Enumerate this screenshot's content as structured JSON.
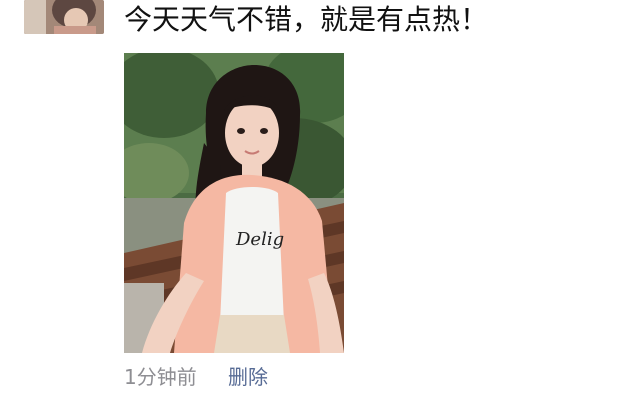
{
  "post": {
    "text": "今天天气不错，就是有点热！",
    "time": "1分钟前",
    "delete_label": "删除"
  },
  "icons": {
    "avatar": "user-avatar-image",
    "photo": "selfie-photo"
  },
  "colors": {
    "text": "#111111",
    "meta": "#8e8e93",
    "link": "#576b95"
  }
}
